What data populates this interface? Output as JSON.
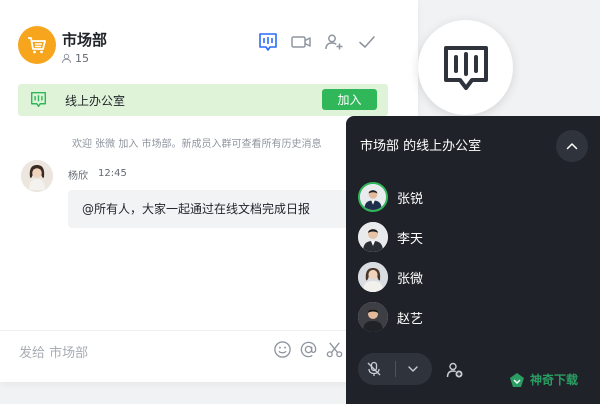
{
  "chat": {
    "title": "市场部",
    "member_count": "15",
    "header_icons": [
      "office-icon",
      "video-call-icon",
      "add-member-icon",
      "checkmark-icon"
    ]
  },
  "banner": {
    "label": "线上办公室",
    "join_label": "加入"
  },
  "system_message": "欢迎 张微 加入 市场部。新成员入群可查看所有历史消息",
  "message": {
    "sender": "杨欣",
    "time": "12:45",
    "text": "@所有人，大家一起通过在线文档完成日报"
  },
  "input": {
    "placeholder": "发给 市场部"
  },
  "toolbar_icons": [
    "emoji-icon",
    "mention-icon",
    "scissors-icon"
  ],
  "panel": {
    "title": "市场部 的线上办公室",
    "members": [
      {
        "name": "张锐",
        "speaking": true
      },
      {
        "name": "李天",
        "speaking": false
      },
      {
        "name": "张微",
        "speaking": false
      },
      {
        "name": "赵艺",
        "speaking": false
      }
    ]
  },
  "watermark": {
    "text": "神奇下载"
  },
  "colors": {
    "accent_green": "#2fb75a",
    "banner_bg": "#dff3d9",
    "panel_bg": "#1f2329",
    "group_avatar": "#f7a51c",
    "header_icon": "#2b6cff"
  }
}
